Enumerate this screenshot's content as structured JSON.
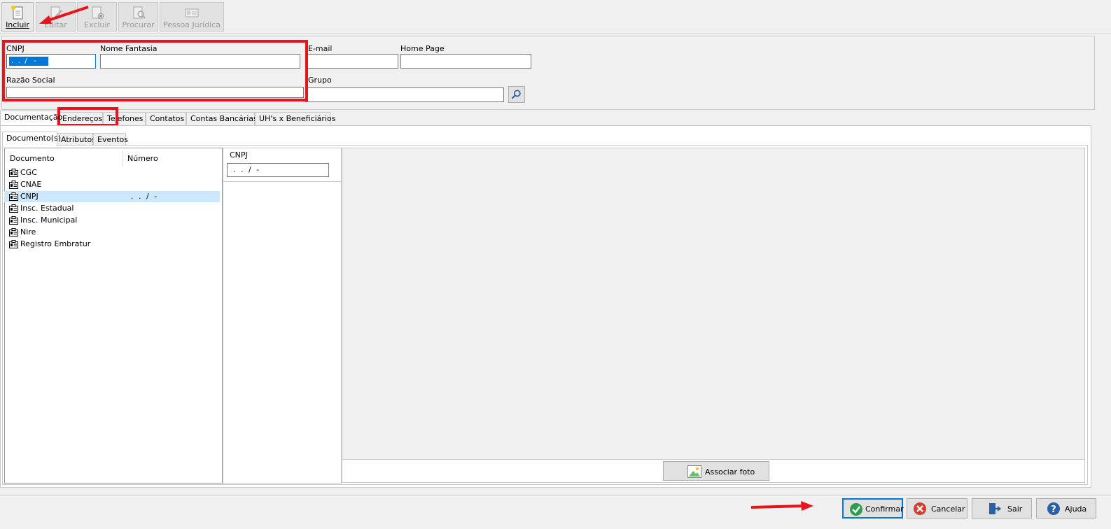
{
  "toolbar": {
    "incluir": "Incluir",
    "editar": "Editar",
    "excluir": "Excluir",
    "procurar": "Procurar",
    "pessoa_juridica": "Pessoa Jurídica"
  },
  "form": {
    "cnpj_label": "CNPJ",
    "cnpj_value": " .  .  /   -",
    "nome_fantasia_label": "Nome Fantasia",
    "nome_fantasia_value": "",
    "email_label": "E-mail",
    "email_value": "",
    "home_page_label": "Home Page",
    "home_page_value": "",
    "razao_social_label": "Razão Social",
    "razao_social_value": "",
    "grupo_label": "Grupo",
    "grupo_value": ""
  },
  "tabs": [
    "Documentação",
    "Endereços",
    "Telefones",
    "Contatos",
    "Contas Bancárias",
    "UH's x Beneficiários"
  ],
  "subtabs": [
    "Documento(s)",
    "Atributos",
    "Eventos"
  ],
  "doc_list": {
    "col_documento": "Documento",
    "col_numero": "Número",
    "rows": [
      {
        "name": "CGC",
        "number": ""
      },
      {
        "name": "CNAE",
        "number": ""
      },
      {
        "name": "CNPJ",
        "number": ". . / -"
      },
      {
        "name": "Insc. Estadual",
        "number": ""
      },
      {
        "name": "Insc. Municipal",
        "number": ""
      },
      {
        "name": "Nire",
        "number": ""
      },
      {
        "name": "Registro Embratur",
        "number": ""
      }
    ],
    "selected_index": 2
  },
  "detail": {
    "label": "CNPJ",
    "value": ". . / -"
  },
  "photo": {
    "button": "Associar foto"
  },
  "footer": {
    "confirmar": "Confirmar",
    "cancelar": "Cancelar",
    "sair": "Sair",
    "ajuda": "Ajuda"
  },
  "colors": {
    "annotation_red": "#e8141c",
    "selection_blue": "#0078d7",
    "selected_row": "#cce8ff"
  }
}
